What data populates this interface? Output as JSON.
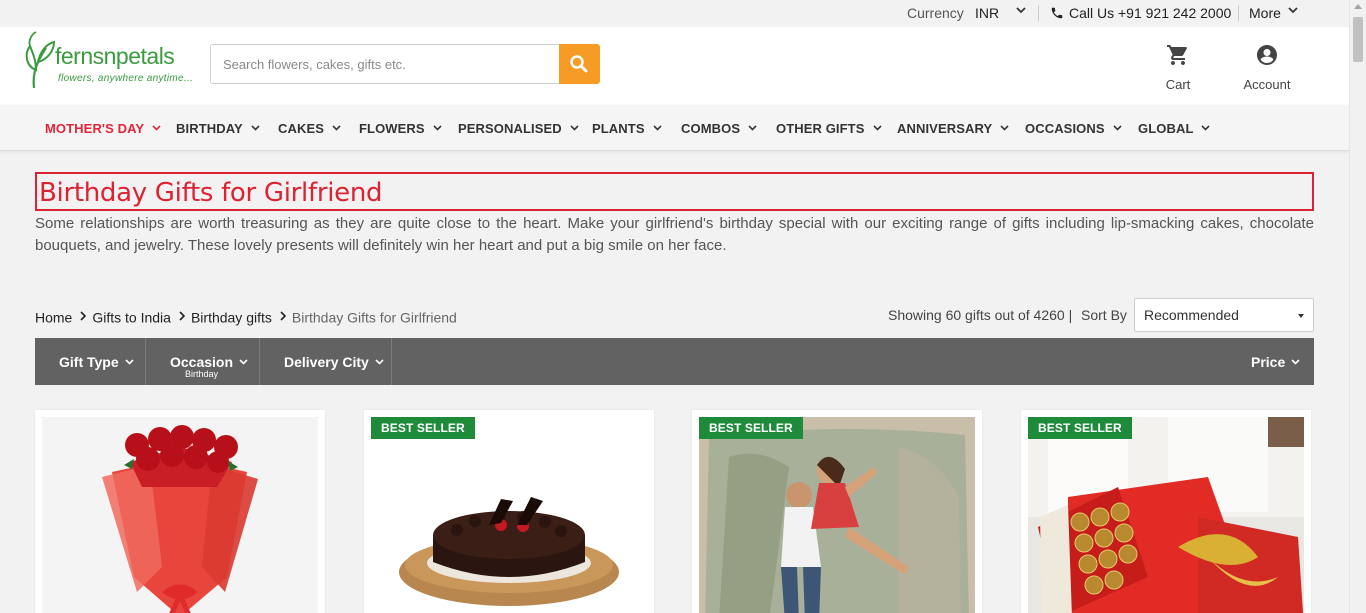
{
  "topbar": {
    "currency_label": "Currency",
    "currency_value": "INR",
    "call_label": "Call Us +91 921 242 2000",
    "more_label": "More"
  },
  "header": {
    "logo_wordmark": "fernsnpetals",
    "logo_tagline": "flowers, anywhere anytime...",
    "search_placeholder": "Search flowers, cakes, gifts etc.",
    "cart_label": "Cart",
    "account_label": "Account"
  },
  "nav": {
    "items": [
      {
        "label": "MOTHER'S DAY",
        "active": true
      },
      {
        "label": "BIRTHDAY"
      },
      {
        "label": "CAKES"
      },
      {
        "label": "FLOWERS"
      },
      {
        "label": "PERSONALISED"
      },
      {
        "label": "PLANTS"
      },
      {
        "label": "COMBOS"
      },
      {
        "label": "OTHER GIFTS"
      },
      {
        "label": "ANNIVERSARY"
      },
      {
        "label": "OCCASIONS"
      },
      {
        "label": "GLOBAL"
      }
    ]
  },
  "page": {
    "title": "Birthday Gifts for Girlfriend",
    "description": "Some relationships are worth treasuring as they are quite close to the heart. Make your girlfriend's birthday special with our exciting range of gifts including lip-smacking cakes, chocolate bouquets, and jewelry. These lovely presents will definitely win her heart and put a big smile on her face."
  },
  "breadcrumb": {
    "items": [
      "Home",
      "Gifts to India",
      "Birthday gifts",
      "Birthday Gifts for Girlfriend"
    ]
  },
  "results": {
    "showing": "Showing 60 gifts out of 4260 |",
    "sort_label": "Sort By",
    "sort_value": "Recommended"
  },
  "filters": {
    "gift_type": "Gift Type",
    "occasion": "Occasion",
    "occasion_sub": "Birthday",
    "delivery_city": "Delivery City",
    "price": "Price"
  },
  "products": [
    {
      "badge": "",
      "image": "red-roses-bouquet"
    },
    {
      "badge": "BEST SELLER",
      "image": "chocolate-truffle-cake"
    },
    {
      "badge": "BEST SELLER",
      "image": "personalised-photo-cushion"
    },
    {
      "badge": "BEST SELLER",
      "image": "ferrero-rocher-bouquet"
    }
  ],
  "colors": {
    "brand_green": "#3a9b3f",
    "accent_orange": "#f59b26",
    "title_red": "#dd2233",
    "badge_green": "#1e8b3b",
    "filter_bar": "#626262"
  }
}
